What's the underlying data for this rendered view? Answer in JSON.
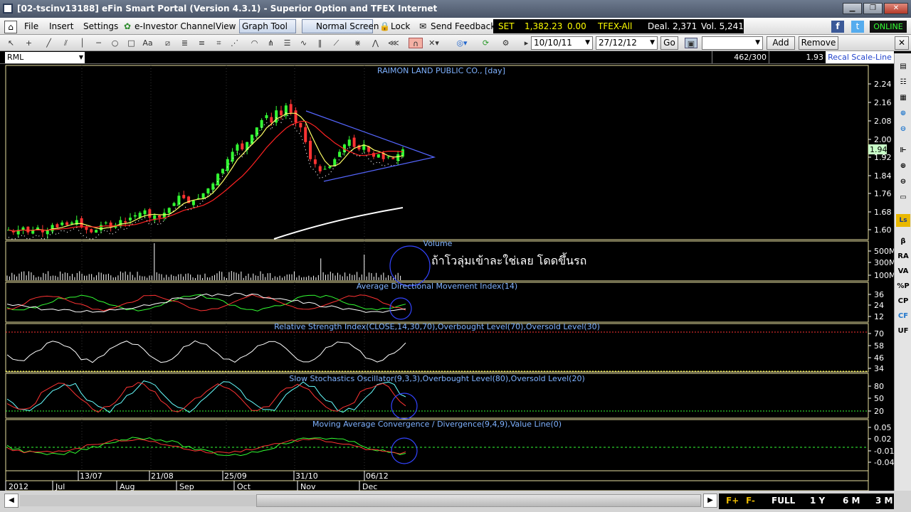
{
  "window": {
    "title": "[02-tscinv13188] eFin Smart Portal (Version 4.3.1) - Superior Option and TFEX Internet"
  },
  "menu": {
    "file": "File",
    "insert": "Insert",
    "settings": "Settings",
    "einvestor": "e-Investor Channel",
    "view": "View",
    "graph_tool": "Graph Tool",
    "normal_screen": "Normal Screen",
    "lock": "Lock",
    "send_feedback": "Send Feedback",
    "online": "ONLINE"
  },
  "ticker": {
    "index_name": "SET",
    "index_value": "1,382.23",
    "change": "0.00",
    "tfex": "TFEX-All",
    "deal": "Deal. 2,371",
    "vol": "Vol. 5,241"
  },
  "toolbar": {
    "date_from": "10/10/11",
    "date_to": "27/12/12",
    "go": "Go",
    "add": "Add",
    "remove": "Remove",
    "symbol": "RML"
  },
  "chart_header": {
    "ratio": "462/300",
    "value": "1.93",
    "recal": "Recal Scale-Line"
  },
  "colors": {
    "price_axis": "#ffffff",
    "ema_fast": "#ffff66",
    "ema_red": "#ff2222",
    "ema_white": "#ffffff",
    "trend": "#5566ff",
    "annotation": "#3344ff"
  },
  "annotation_text": "ถ้าโวลุ่มเข้าละใช่เลย โดดขึ้นรถ",
  "right_tools": [
    "β",
    "RA",
    "VA",
    "%P",
    "CP",
    "CF",
    "UF"
  ],
  "bottom": {
    "full": "FULL",
    "1y": "1 Y",
    "6m": "6 M",
    "3m": "3 M",
    "f1": "F+",
    "f2": "F-"
  },
  "chart_data": [
    {
      "type": "candlestick",
      "title": "RAIMON LAND PUBLIC CO., [day]",
      "y_ticks": [
        "2.24",
        "2.16",
        "2.08",
        "2.00",
        "1.92",
        "1.84",
        "1.76",
        "1.68",
        "1.60"
      ],
      "last_price": "1.94",
      "ylim": [
        1.57,
        2.29
      ],
      "series": [
        {
          "name": "price",
          "values": [
            1.61,
            1.6,
            1.61,
            1.62,
            1.6,
            1.61,
            1.62,
            1.6,
            1.61,
            1.63,
            1.62,
            1.64,
            1.63,
            1.64,
            1.65,
            1.62,
            1.61,
            1.6,
            1.61,
            1.63,
            1.64,
            1.62,
            1.63,
            1.65,
            1.64,
            1.66,
            1.67,
            1.68,
            1.69,
            1.66,
            1.67,
            1.66,
            1.68,
            1.7,
            1.72,
            1.75,
            1.74,
            1.72,
            1.73,
            1.74,
            1.76,
            1.78,
            1.8,
            1.84,
            1.86,
            1.9,
            1.93,
            1.96,
            1.94,
            1.97,
            2.0,
            2.03,
            2.06,
            2.08,
            2.05,
            2.1,
            2.08,
            2.12,
            2.09,
            2.05,
            2.03,
            1.97,
            1.9,
            1.88,
            1.85,
            1.86,
            1.87,
            1.9,
            1.93,
            1.96,
            1.98,
            1.95,
            1.94,
            1.96,
            1.93,
            1.91,
            1.92,
            1.9,
            1.91,
            1.9,
            1.92,
            1.94
          ]
        }
      ]
    },
    {
      "type": "bar",
      "title": "Volume",
      "y_ticks": [
        "500M",
        "300M",
        "100M"
      ]
    },
    {
      "type": "line",
      "title": "Average Directional Movement Index(14)",
      "y_ticks": [
        "36",
        "24",
        "12"
      ]
    },
    {
      "type": "line",
      "title": "Relative Strength Index(CLOSE,14,30,70),Overbought Level(70),Oversold Level(30)",
      "y_ticks": [
        "70",
        "58",
        "46",
        "34"
      ]
    },
    {
      "type": "line",
      "title": "Slow Stochastics Oscillator(9,3,3),Overbought Level(80),Oversold Level(20)",
      "y_ticks": [
        "80",
        "50",
        "20"
      ]
    },
    {
      "type": "line",
      "title": "Moving Average Convergence / Divergence(9,4,9),Value Line(0)",
      "y_ticks": [
        "0.05",
        "0.02",
        "-0.01",
        "-0.04"
      ]
    }
  ],
  "x_axis": {
    "dates": [
      "13/07",
      "21/08",
      "25/09",
      "31/10",
      "06/12"
    ],
    "months": [
      "2012",
      "Jul",
      "Aug",
      "Sep",
      "Oct",
      "Nov",
      "Dec"
    ]
  }
}
